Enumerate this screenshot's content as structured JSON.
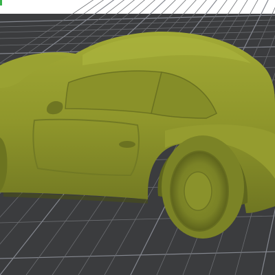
{
  "app": {
    "view": "3d-viewport",
    "object": "car-model"
  },
  "icons": {
    "object_icon": "car-model-icon"
  },
  "colors": {
    "bed": "#3b3c3e",
    "grid_line": "#6c6e72",
    "grid_major": "#858890",
    "model": "#8f962b",
    "model_shadow": "#6c7420",
    "model_highlight": "#aab23c",
    "top_bar": "#ffffff",
    "accent": "#37b24a"
  }
}
